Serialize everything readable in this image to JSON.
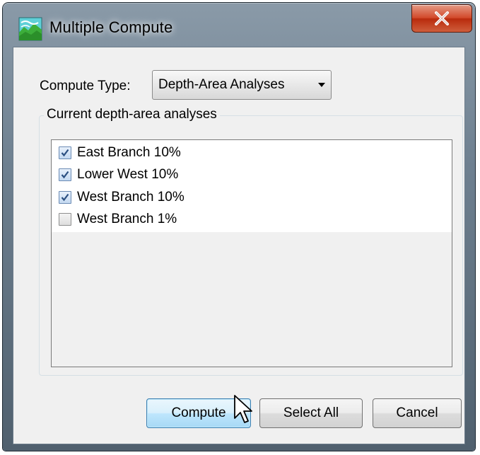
{
  "window": {
    "title": "Multiple Compute",
    "title_icon": "map-landscape-icon",
    "close_icon": "close-icon"
  },
  "compute_type": {
    "label": "Compute Type:",
    "selected": "Depth-Area Analyses",
    "arrow_icon": "chevron-down-icon"
  },
  "group": {
    "legend": "Current depth-area analyses",
    "items": [
      {
        "label": "East Branch 10%",
        "checked": true
      },
      {
        "label": "Lower West 10%",
        "checked": true
      },
      {
        "label": "West Branch 10%",
        "checked": true
      },
      {
        "label": "West Branch 1%",
        "checked": false
      }
    ]
  },
  "buttons": {
    "compute": "Compute",
    "select_all": "Select All",
    "cancel": "Cancel"
  },
  "colors": {
    "default_button_border": "#3c7fb1",
    "close_button": "#c7391a",
    "checkmark": "#2b4f80"
  }
}
